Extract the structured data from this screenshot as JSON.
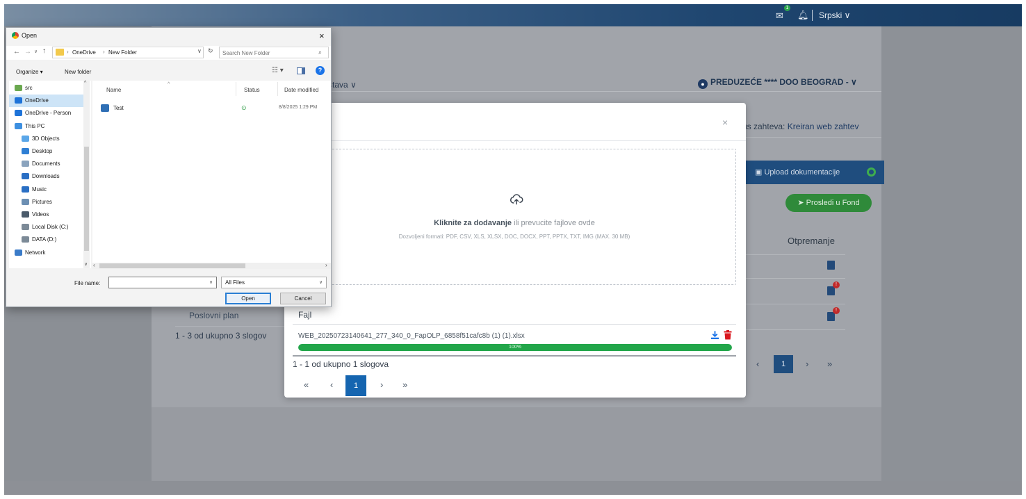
{
  "topbar": {
    "language": "Srpski ∨",
    "notification_count": "1"
  },
  "background_page": {
    "nav_item_partial": "stava ∨",
    "company": "PREDUZEĆE **** DOO BEOGRAD - ∨",
    "status_label": "us zahteva:",
    "status_value": "Kreiran web zahtev",
    "upload_tab_label": "Upload dokumentacije",
    "forward_button": "Prosledi u Fond",
    "column_header": "Otpremanje",
    "row_label": "Poslovni plan",
    "pagination_text": "1 - 3 od ukupno 3 slogov",
    "pager": {
      "first": "«",
      "prev": "‹",
      "current": "1",
      "next": "›",
      "last": "»"
    },
    "badge": "!"
  },
  "upload_modal": {
    "close": "×",
    "dropzone_strong": "Kliknite za dodavanje",
    "dropzone_rest": " ili prevucite fajlove ovde",
    "dropzone_formats": "Dozvoljeni formati: PDF, CSV, XLS, XLSX, DOC, DOCX, PPT, PPTX, TXT, IMG (MAX. 30 MB)",
    "file_column_header": "Fajl",
    "file_name": "WEB_20250723140641_277_340_0_FapOLP_6858f51cafc8b (1) (1).xlsx",
    "progress_percent": 100,
    "progress_label": "100%",
    "pagination_text": "1 - 1 od ukupno 1 slogova",
    "pager": {
      "first": "«",
      "prev": "‹",
      "current": "1",
      "next": "›",
      "last": "»"
    },
    "colors": {
      "progress": "#22a64a",
      "active_page": "#1565b0",
      "trash": "#d9181f",
      "download": "#1a73e8"
    }
  },
  "file_dialog": {
    "title": "Open",
    "close": "×",
    "nav": {
      "back": "←",
      "forward": "→",
      "recent": "∨",
      "up": "↑"
    },
    "breadcrumb": [
      "OneDrive",
      "New Folder"
    ],
    "address_dropdown": "∨",
    "refresh": "↻",
    "search_placeholder": "Search New Folder",
    "search_icon": "⌕",
    "toolbar": {
      "organize": "Organize ▾",
      "new_folder": "New folder",
      "view": "☷ ▾",
      "help": "?"
    },
    "nav_pane": [
      {
        "label": "src",
        "icon": "folder-chrome-icon"
      },
      {
        "label": "OneDrive",
        "icon": "onedrive-icon"
      },
      {
        "label": "OneDrive - Person",
        "icon": "onedrive-icon"
      },
      {
        "label": "This PC",
        "icon": "computer-icon"
      },
      {
        "label": "3D Objects",
        "icon": "3d-objects-icon"
      },
      {
        "label": "Desktop",
        "icon": "desktop-icon"
      },
      {
        "label": "Documents",
        "icon": "documents-icon"
      },
      {
        "label": "Downloads",
        "icon": "downloads-icon"
      },
      {
        "label": "Music",
        "icon": "music-icon"
      },
      {
        "label": "Pictures",
        "icon": "pictures-icon"
      },
      {
        "label": "Videos",
        "icon": "videos-icon"
      },
      {
        "label": "Local Disk (C:)",
        "icon": "disk-icon"
      },
      {
        "label": "DATA (D:)",
        "icon": "disk-icon"
      },
      {
        "label": "Network",
        "icon": "network-icon"
      }
    ],
    "columns": {
      "name": "Name",
      "status": "Status",
      "date_modified": "Date modified",
      "sort_indicator": "^"
    },
    "files": [
      {
        "name": "Test",
        "status": "⊙",
        "date_modified": "8/8/2025 1:29 PM"
      }
    ],
    "file_name_label": "File name:",
    "file_name_value": "",
    "filter": "All Files",
    "open_button": "Open",
    "cancel_button": "Cancel",
    "scroll": {
      "up": "^",
      "down": "∨",
      "left": "‹",
      "right": "›"
    }
  }
}
